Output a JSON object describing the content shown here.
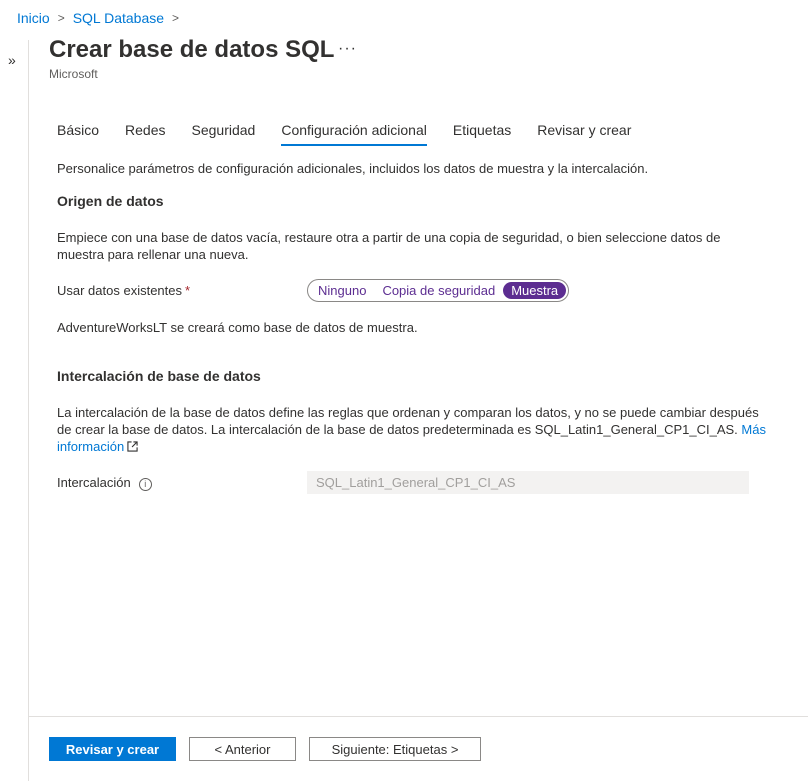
{
  "breadcrumb": {
    "items": [
      "Inicio",
      "SQL Database"
    ],
    "separator": ">"
  },
  "header": {
    "title": "Crear base de datos SQL",
    "subtitle": "Microsoft",
    "more": "···"
  },
  "tabs": [
    {
      "label": "Básico",
      "active": false
    },
    {
      "label": "Redes",
      "active": false
    },
    {
      "label": "Seguridad",
      "active": false
    },
    {
      "label": "Configuración adicional",
      "active": true
    },
    {
      "label": "Etiquetas",
      "active": false
    },
    {
      "label": "Revisar y crear",
      "active": false
    }
  ],
  "intro": "Personalice parámetros de configuración adicionales, incluidos los datos de muestra y la intercalación.",
  "data_source": {
    "title": "Origen de datos",
    "description_line1": "Empiece con una base de datos vacía, restaure otra a partir de una copia de seguridad, o bien seleccione datos de",
    "description_line2": "muestra para rellenar una nueva.",
    "use_existing_label": "Usar datos existentes",
    "required_marker": "*",
    "options": [
      "Ninguno",
      "Copia de seguridad",
      "Muestra"
    ],
    "selected": "Muestra",
    "sample_note": "AdventureWorksLT se creará como base de datos de muestra."
  },
  "collation": {
    "title": "Intercalación de base de datos",
    "description_line1": "La intercalación de la base de datos define las reglas que ordenan y comparan los datos, y no se puede cambiar después",
    "description_line2": "de crear la base de datos. La intercalación de la base de datos predeterminada es SQL_Latin1_General_CP1_CI_AS.",
    "link_part1": "Más",
    "link_part2": "información",
    "field_label": "Intercalación",
    "info_glyph": "i",
    "field_value": "SQL_Latin1_General_CP1_CI_AS"
  },
  "footer": {
    "review_create": "Revisar y crear",
    "previous": "< Anterior",
    "next": "Siguiente: Etiquetas >"
  },
  "colors": {
    "accent": "#0078d4",
    "toggle": "#5c2d91",
    "required": "#a4262c"
  }
}
